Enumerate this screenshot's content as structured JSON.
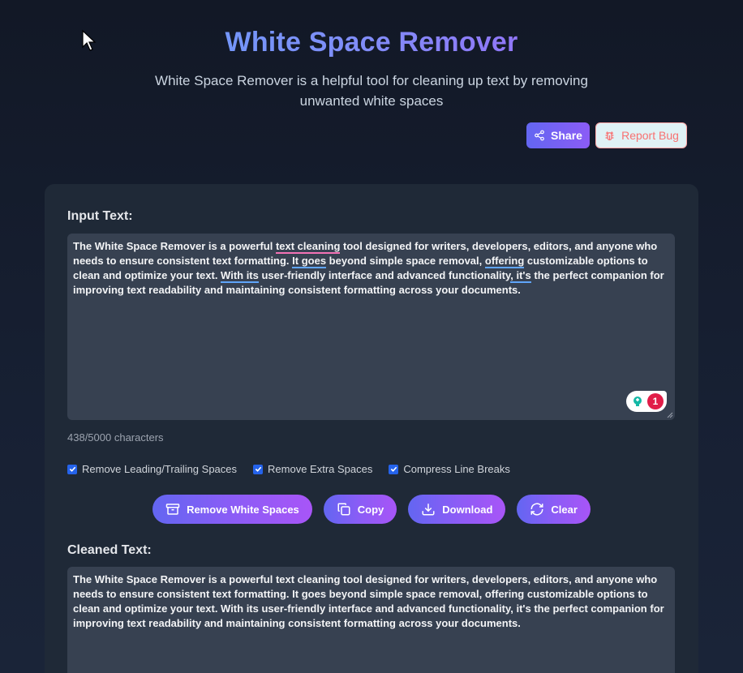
{
  "header": {
    "title": "White Space Remover",
    "subtitle": "White Space Remover is a helpful tool for cleaning up text by removing unwanted white spaces",
    "share_label": "Share",
    "report_bug_label": "Report Bug"
  },
  "input": {
    "label": "Input Text:",
    "text_parts": [
      "The White Space Remover is a powerful ",
      "text cleaning",
      " tool designed for writers, developers, editors, and anyone who needs to ensure consistent text formatting. ",
      "It goes",
      " beyond simple space removal, ",
      "offering",
      " customizable options to clean and optimize your text. ",
      "With its",
      " user-friendly interface and advanced functionality",
      ", it's",
      " the perfect companion for improving text readability and maintaining consistent formatting across your documents."
    ],
    "char_count": "438/5000 characters",
    "grammarly_count": "1"
  },
  "options": {
    "leading_trailing": "Remove Leading/Trailing Spaces",
    "extra_spaces": "Remove Extra Spaces",
    "compress_breaks": "Compress Line Breaks"
  },
  "actions": {
    "remove": "Remove White Spaces",
    "copy": "Copy",
    "download": "Download",
    "clear": "Clear"
  },
  "output": {
    "label": "Cleaned Text:",
    "text": "The White Space Remover is a powerful text cleaning tool designed for writers, developers, editors, and anyone who needs to ensure consistent text formatting. It goes beyond simple space removal, offering customizable options to clean and optimize your text. With its user-friendly interface and advanced functionality, it's the perfect companion for improving text readability and maintaining consistent formatting across your documents."
  },
  "colors": {
    "accent_start": "#6366f1",
    "accent_end": "#a855f7",
    "card_bg": "#1f2937",
    "textbox_bg": "#374151"
  }
}
